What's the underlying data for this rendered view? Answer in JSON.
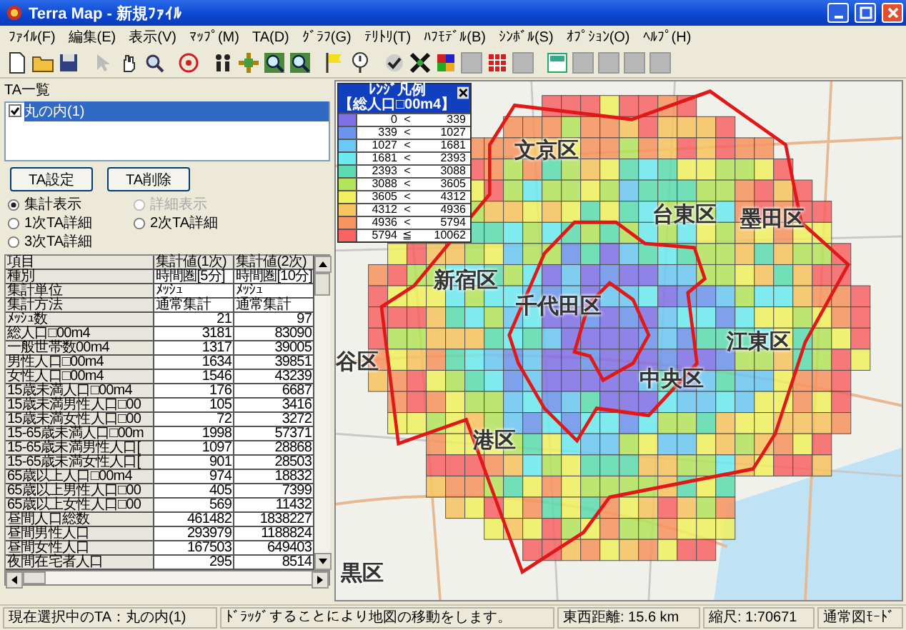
{
  "window": {
    "title": "Terra Map - 新規ﾌｧｲﾙ"
  },
  "menu": [
    "ﾌｧｲﾙ(F)",
    "編集(E)",
    "表示(V)",
    "ﾏｯﾌﾟ(M)",
    "TA(D)",
    "ｸﾞﾗﾌ(G)",
    "ﾃﾘﾄﾘ(T)",
    "ﾊﾌﾓﾃﾞﾙ(B)",
    "ｼﾝﾎﾞﾙ(S)",
    "ｵﾌﾟｼｮﾝ(O)",
    "ﾍﾙﾌﾟ(H)"
  ],
  "ta_panel": {
    "label": "TA一覧",
    "list": [
      {
        "label": "丸の内(1)",
        "checked": true,
        "selected": true
      }
    ],
    "buttons": [
      "TA設定",
      "TA削除"
    ],
    "radios": [
      {
        "label": "集計表示",
        "selected": true,
        "disabled": false
      },
      {
        "label": "詳細表示",
        "selected": false,
        "disabled": true
      },
      {
        "label": "1次TA詳細",
        "selected": false,
        "disabled": false
      },
      {
        "label": "2次TA詳細",
        "selected": false,
        "disabled": false
      },
      {
        "label": "3次TA詳細",
        "selected": false,
        "disabled": false
      }
    ]
  },
  "table": {
    "columns": [
      "項目",
      "集計値(1次)",
      "集計値(2次)"
    ],
    "rows": [
      [
        "種別",
        "時間圏[5分]",
        "時間圏[10分]"
      ],
      [
        "集計単位",
        "ﾒｯｼｭ",
        "ﾒｯｼｭ"
      ],
      [
        "集計方法",
        "通常集計",
        "通常集計"
      ],
      [
        "ﾒｯｼｭ数",
        "21",
        "97"
      ],
      [
        "総人口□00m4",
        "3181",
        "83090"
      ],
      [
        "一般世帯数00m4",
        "1317",
        "39005"
      ],
      [
        "男性人口□00m4",
        "1634",
        "39851"
      ],
      [
        "女性人口□00m4",
        "1546",
        "43239"
      ],
      [
        "15歳未満人口□00m4",
        "176",
        "6687"
      ],
      [
        "15歳未満男性人口□00",
        "105",
        "3416"
      ],
      [
        "15歳未満女性人口□00",
        "72",
        "3272"
      ],
      [
        "15-65歳未満人口□00m",
        "1998",
        "57371"
      ],
      [
        "15-65歳未満男性人口[",
        "1097",
        "28868"
      ],
      [
        "15-65歳未満女性人口[",
        "901",
        "28503"
      ],
      [
        "65歳以上人口□00m4",
        "974",
        "18832"
      ],
      [
        "65歳以上男性人口□00",
        "405",
        "7399"
      ],
      [
        "65歳以上女性人口□00",
        "569",
        "11432"
      ],
      [
        "昼間人口総数",
        "461482",
        "1838227"
      ],
      [
        "昼間男性人口",
        "293979",
        "1188824"
      ],
      [
        "昼間女性人口",
        "167503",
        "649403"
      ],
      [
        "夜間在宅者人口",
        "295",
        "8514"
      ]
    ]
  },
  "legend": {
    "title": "ﾚﾝｼﾞ凡例",
    "subtitle": "【総人口□00m4】",
    "ranges": [
      {
        "from": "0",
        "op": "<",
        "to": "339",
        "color": "#8070e8"
      },
      {
        "from": "339",
        "op": "<",
        "to": "1027",
        "color": "#6c94ec"
      },
      {
        "from": "1027",
        "op": "<",
        "to": "1681",
        "color": "#6cc8f4"
      },
      {
        "from": "1681",
        "op": "<",
        "to": "2393",
        "color": "#6ceaf0"
      },
      {
        "from": "2393",
        "op": "<",
        "to": "3088",
        "color": "#5cdcb0"
      },
      {
        "from": "3088",
        "op": "<",
        "to": "3605",
        "color": "#b4e45c"
      },
      {
        "from": "3605",
        "op": "<",
        "to": "4312",
        "color": "#f0f060"
      },
      {
        "from": "4312",
        "op": "<",
        "to": "4936",
        "color": "#f8c460"
      },
      {
        "from": "4936",
        "op": "<",
        "to": "5794",
        "color": "#f89460"
      },
      {
        "from": "5794",
        "op": "≦",
        "to": "10062",
        "color": "#f86464"
      }
    ]
  },
  "map": {
    "labels": [
      "文京区",
      "台東区",
      "墨田区",
      "新宿区",
      "千代田区",
      "江東区",
      "谷区",
      "中央区",
      "港区",
      "黒区"
    ]
  },
  "status_bar": [
    "現在選択中のTA：丸の内(1)",
    "ﾄﾞﾗｯｸﾞすることにより地図の移動をします。",
    "東西距離: 15.6 km",
    "縮尺: 1:70671",
    "通常図ﾓｰﾄﾞ"
  ]
}
